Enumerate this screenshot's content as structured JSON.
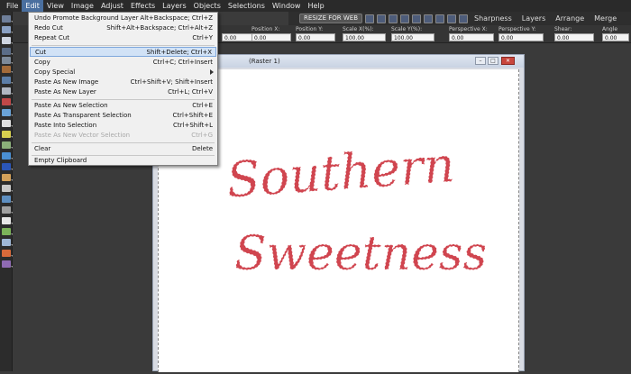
{
  "menubar": {
    "items": [
      "File",
      "Edit",
      "View",
      "Image",
      "Adjust",
      "Effects",
      "Layers",
      "Objects",
      "Selections",
      "Window",
      "Help"
    ],
    "active": "Edit"
  },
  "toolbar": {
    "preset_label": "RESIZE FOR WEB",
    "menus": [
      "Sharpness",
      "Layers",
      "Arrange",
      "Merge"
    ]
  },
  "options": {
    "fields": [
      {
        "label": "Position X:",
        "value": "0.00"
      },
      {
        "label": "Position Y:",
        "value": "0.00"
      },
      {
        "label": "Scale X(%):",
        "value": "100.00"
      },
      {
        "label": "Scale Y(%):",
        "value": "100.00"
      },
      {
        "label": "Perspective X:",
        "value": "0.00"
      },
      {
        "label": "Perspective Y:",
        "value": "0.00"
      },
      {
        "label": "Shear:",
        "value": "0.00"
      },
      {
        "label": "Angle",
        "value": "0.00"
      }
    ],
    "field0_value": "0.00"
  },
  "document": {
    "title": "(Raster 1)",
    "text_line1": "Southern",
    "text_line2": "Sweetness"
  },
  "edit_menu": {
    "items": [
      {
        "label": "Undo Promote Background Layer",
        "shortcut": "Alt+Backspace; Ctrl+Z"
      },
      {
        "label": "Redo Cut",
        "shortcut": "Shift+Alt+Backspace; Ctrl+Alt+Z"
      },
      {
        "label": "Repeat Cut",
        "shortcut": "Ctrl+Y"
      },
      {
        "label": "Cut",
        "shortcut": "Shift+Delete; Ctrl+X"
      },
      {
        "label": "Copy",
        "shortcut": "Ctrl+C; Ctrl+Insert"
      },
      {
        "label": "Copy Special",
        "shortcut": ""
      },
      {
        "label": "Paste As New Image",
        "shortcut": "Ctrl+Shift+V; Shift+Insert"
      },
      {
        "label": "Paste As New Layer",
        "shortcut": "Ctrl+L; Ctrl+V"
      },
      {
        "label": "Paste As New Selection",
        "shortcut": "Ctrl+E"
      },
      {
        "label": "Paste As Transparent Selection",
        "shortcut": "Ctrl+Shift+E"
      },
      {
        "label": "Paste Into Selection",
        "shortcut": "Ctrl+Shift+L"
      },
      {
        "label": "Paste As New Vector Selection",
        "shortcut": "Ctrl+G"
      },
      {
        "label": "Clear",
        "shortcut": "Delete"
      },
      {
        "label": "Empty Clipboard",
        "shortcut": ""
      }
    ]
  },
  "colors": {
    "accent": "#4a6f9f",
    "text_red": "#d0454f"
  }
}
